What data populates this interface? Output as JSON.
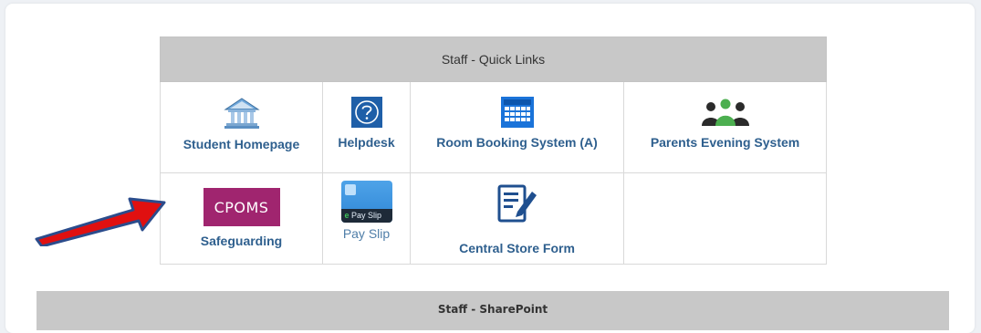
{
  "quick_links": {
    "title": "Staff - Quick Links",
    "items": [
      {
        "label": "Student Homepage",
        "icon": "building-icon"
      },
      {
        "label": "Helpdesk",
        "icon": "help-icon"
      },
      {
        "label": "Room Booking System (A)",
        "icon": "calendar-icon"
      },
      {
        "label": "Parents Evening System",
        "icon": "people-icon"
      },
      {
        "label": "Safeguarding",
        "icon": "cpoms-logo",
        "logo_text": "CPOMS"
      },
      {
        "label": "Pay Slip",
        "icon": "pay-slip-icon",
        "logo_text": "Pay Slip"
      },
      {
        "label": "Central Store Form",
        "icon": "form-edit-icon"
      }
    ]
  },
  "sharepoint": {
    "title": "Staff - SharePoint"
  },
  "colors": {
    "header_gray": "#c8c8c8",
    "link_blue": "#2e5f8e",
    "cpoms_magenta": "#a0256f",
    "arrow_red": "#e01010",
    "arrow_outline": "#2b4c8c"
  }
}
